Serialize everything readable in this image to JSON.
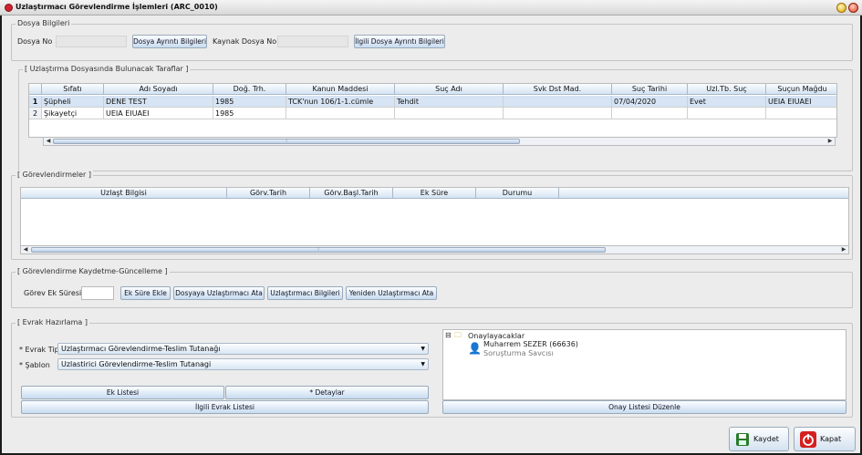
{
  "window": {
    "title": "Uzlaştırmacı Görevlendirme İşlemleri (ARC_0010)"
  },
  "dosya": {
    "group_title": "Dosya Bilgileri",
    "dosya_no_label": "Dosya No",
    "dosya_detail_btn": "Dosya Ayrıntı Bilgileri",
    "kaynak_label": "Kaynak Dosya No",
    "ilgili_detail_btn": "İlgili Dosya Ayrıntı Bilgileri"
  },
  "taraflar": {
    "group_title": "[ Uzlaştırma Dosyasında Bulunacak Taraflar ]",
    "columns": [
      "Sıfatı",
      "Adı Soyadı",
      "Doğ. Trh.",
      "Kanun Maddesi",
      "Suç Adı",
      "Svk Dst Mad.",
      "Suç Tarihi",
      "Uzl.Tb. Suç",
      "Suçun Mağdu"
    ],
    "rows": [
      {
        "num": "1",
        "cells": [
          "Şüpheli",
          "DENE TEST",
          "1985",
          "TCK'nun 106/1-1.cümle",
          "Tehdit",
          "",
          "07/04/2020",
          "Evet",
          "UEIA EIUAEI"
        ]
      },
      {
        "num": "2",
        "cells": [
          "Şikayetçi",
          "UEIA EIUAEI",
          "1985",
          "",
          "",
          "",
          "",
          "",
          ""
        ]
      }
    ]
  },
  "gorev": {
    "group_title": "[ Görevlendirmeler ]",
    "columns": [
      "Uzlaşt Bilgisi",
      "Görv.Tarih",
      "Görv.Başl.Tarih",
      "Ek Süre",
      "Durumu"
    ]
  },
  "kaydet": {
    "group_title": "[ Görevlendirme Kaydetme-Güncelleme ]",
    "ek_sure_label": "Görev Ek Süresi",
    "ek_sure_value": "",
    "buttons": [
      "Ek Süre Ekle",
      "Dosyaya Uzlaştırmacı Ata",
      "Uzlaştırmacı Bilgileri",
      "Yeniden Uzlaştırmacı Ata"
    ]
  },
  "evrak": {
    "group_title": "[ Evrak Hazırlama ]",
    "tip_label": "* Evrak Tipi",
    "tip_value": "Uzlaştırmacı Görevlendirme-Teslim Tutanağı",
    "sablon_label": "* Şablon",
    "sablon_value": "Uzlastirici Görevlendirme-Teslim Tutanagi",
    "ek_listesi": "Ek Listesi",
    "detaylar": "* Detaylar",
    "ilgili_evrak": "İlgili Evrak Listesi"
  },
  "onay": {
    "folder": "Onaylayacaklar",
    "person": "Muharrem SEZER (66636)",
    "role": "Soruşturma Savcısı",
    "edit_btn": "Onay Listesi Düzenle"
  },
  "footer": {
    "save": "Kaydet",
    "close": "Kapat"
  }
}
